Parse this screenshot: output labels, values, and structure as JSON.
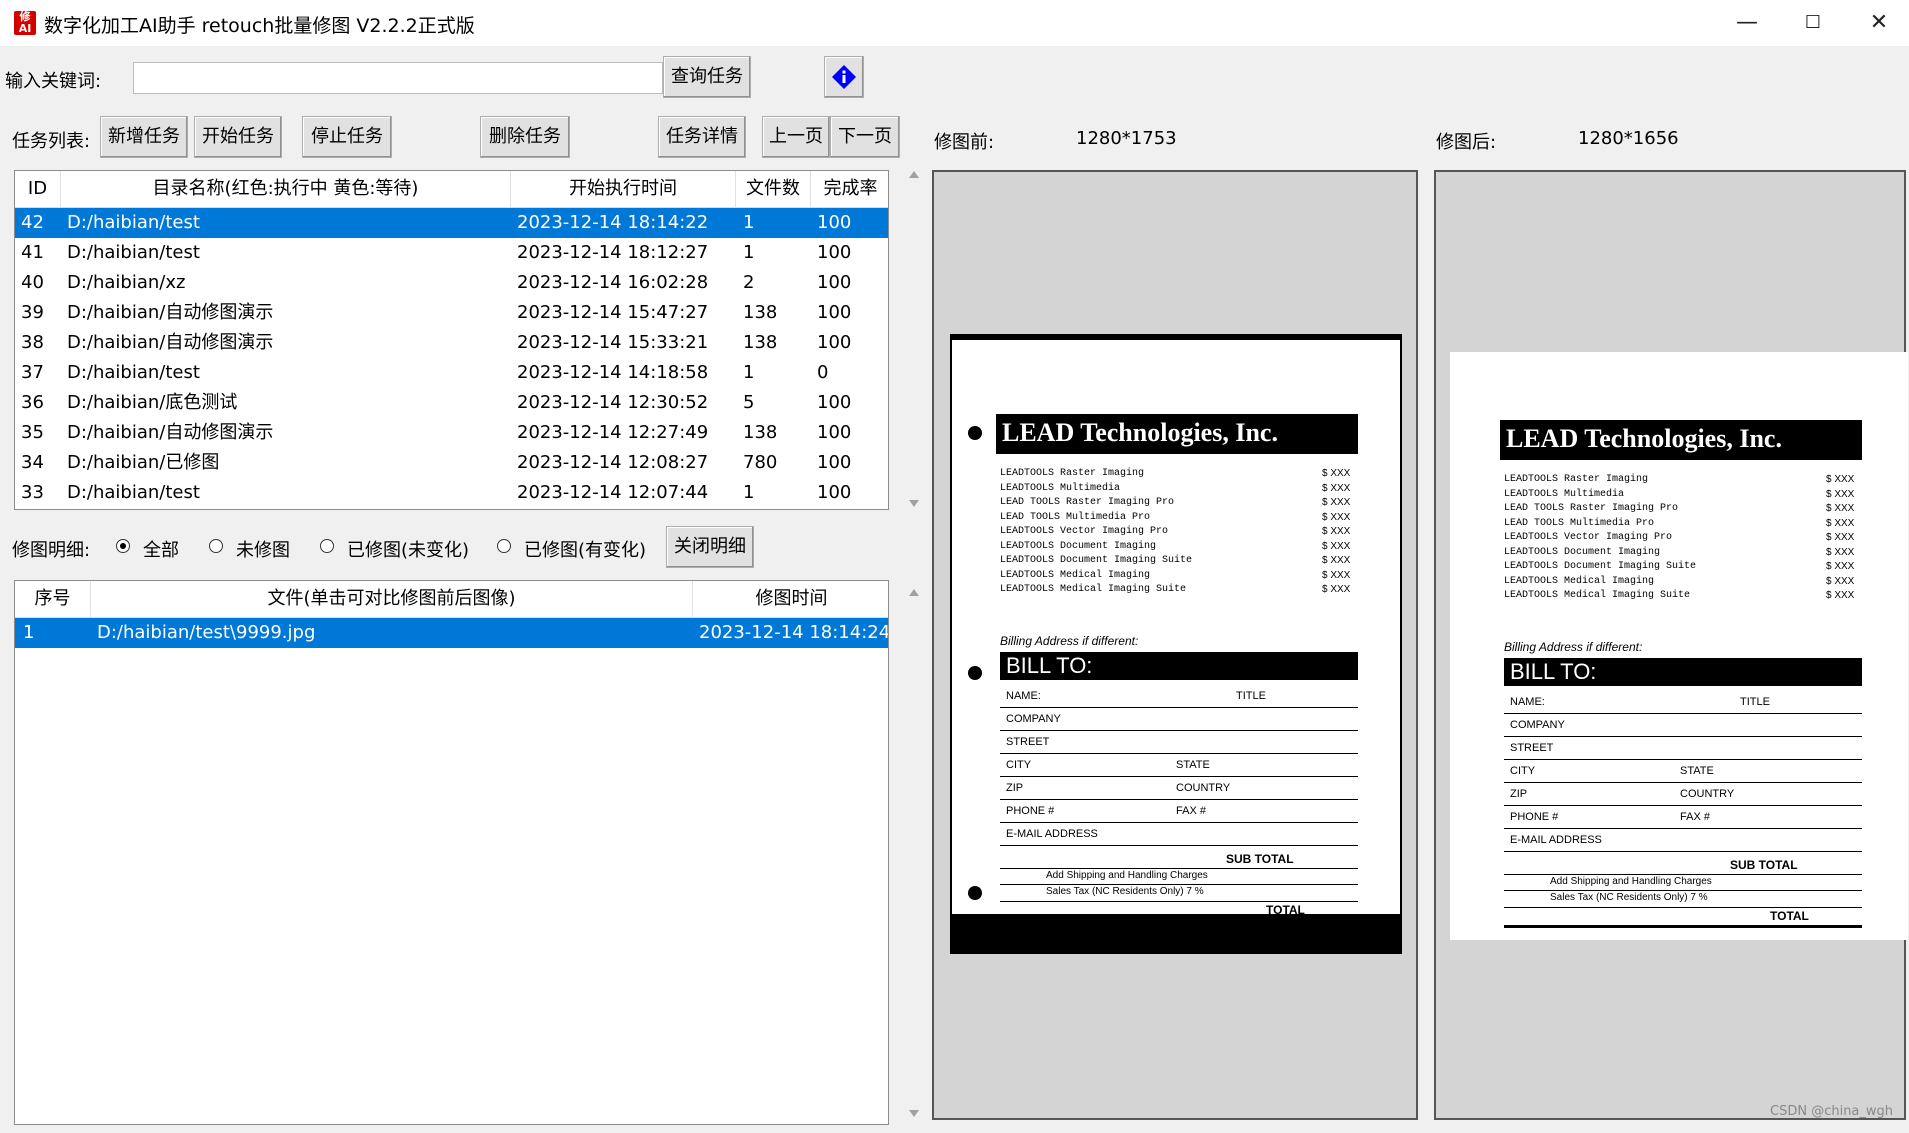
{
  "window": {
    "title": "数字化加工AI助手   retouch批量修图 V2.2.2正式版",
    "icon_text": "修\nAI",
    "minimize_icon": "minimize-icon",
    "maximize_icon": "maximize-icon",
    "close_icon": "close-icon"
  },
  "search": {
    "label": "输入关键词:",
    "value": "",
    "query_button": "查询任务",
    "info_icon": "info-icon"
  },
  "toolbar": {
    "task_list_label": "任务列表:",
    "add_task": "新增任务",
    "start_task": "开始任务",
    "stop_task": "停止任务",
    "delete_task": "删除任务",
    "task_detail": "任务详情",
    "prev_page": "上一页",
    "next_page": "下一页"
  },
  "task_table": {
    "columns": [
      "ID",
      "目录名称(红色:执行中 黄色:等待)",
      "开始执行时间",
      "文件数",
      "完成率"
    ],
    "rows": [
      {
        "id": "42",
        "dir": "D:/haibian/test",
        "time": "2023-12-14 18:14:22",
        "files": "1",
        "rate": "100"
      },
      {
        "id": "41",
        "dir": "D:/haibian/test",
        "time": "2023-12-14 18:12:27",
        "files": "1",
        "rate": "100"
      },
      {
        "id": "40",
        "dir": "D:/haibian/xz",
        "time": "2023-12-14 16:02:28",
        "files": "2",
        "rate": "100"
      },
      {
        "id": "39",
        "dir": "D:/haibian/自动修图演示",
        "time": "2023-12-14 15:47:27",
        "files": "138",
        "rate": "100"
      },
      {
        "id": "38",
        "dir": "D:/haibian/自动修图演示",
        "time": "2023-12-14 15:33:21",
        "files": "138",
        "rate": "100"
      },
      {
        "id": "37",
        "dir": "D:/haibian/test",
        "time": "2023-12-14 14:18:58",
        "files": "1",
        "rate": "0"
      },
      {
        "id": "36",
        "dir": "D:/haibian/底色测试",
        "time": "2023-12-14 12:30:52",
        "files": "5",
        "rate": "100"
      },
      {
        "id": "35",
        "dir": "D:/haibian/自动修图演示",
        "time": "2023-12-14 12:27:49",
        "files": "138",
        "rate": "100"
      },
      {
        "id": "34",
        "dir": "D:/haibian/已修图",
        "time": "2023-12-14 12:08:27",
        "files": "780",
        "rate": "100"
      },
      {
        "id": "33",
        "dir": "D:/haibian/test",
        "time": "2023-12-14 12:07:44",
        "files": "1",
        "rate": "100"
      }
    ]
  },
  "detail_filter": {
    "label": "修图明细:",
    "options": [
      "全部",
      "未修图",
      "已修图(未变化)",
      "已修图(有变化)"
    ],
    "selected": "全部",
    "close_button": "关闭明细"
  },
  "detail_table": {
    "columns": [
      "序号",
      "文件(单击可对比修图前后图像)",
      "修图时间"
    ],
    "rows": [
      {
        "no": "1",
        "file": "D:/haibian/test\\9999.jpg",
        "time": "2023-12-14 18:14:24"
      }
    ]
  },
  "preview": {
    "before_label": "修图前:",
    "before_size": "1280*1753",
    "after_label": "修图后:",
    "after_size": "1280*1656"
  },
  "document": {
    "company": "LEAD Technologies, Inc.",
    "products": [
      "LEADTOOLS Raster Imaging",
      "LEADTOOLS Multimedia",
      "LEAD TOOLS Raster Imaging Pro",
      "LEAD TOOLS Multimedia Pro",
      "LEADTOOLS Vector Imaging Pro",
      "LEADTOOLS Document Imaging",
      "LEADTOOLS Document Imaging Suite",
      "LEADTOOLS Medical Imaging",
      "LEADTOOLS Medical Imaging Suite"
    ],
    "price": "$ XXX",
    "billing_note": "Billing Address if different:",
    "bill_to": "BILL TO:",
    "fields": [
      "NAME:",
      "TITLE",
      "COMPANY",
      "STREET",
      "CITY",
      "STATE",
      "ZIP",
      "COUNTRY",
      "PHONE #",
      "FAX #",
      "E-MAIL ADDRESS"
    ],
    "sub_total": "SUB TOTAL",
    "shipping": "Add Shipping and Handling Charges",
    "sales_tax": "Sales Tax (NC Residents Only) 7 %",
    "total": "TOTAL"
  },
  "watermark": "CSDN @china_wgh",
  "colors": {
    "selection": "#0078d7",
    "brand_red": "#d40000",
    "info_blue": "#0000ff"
  }
}
